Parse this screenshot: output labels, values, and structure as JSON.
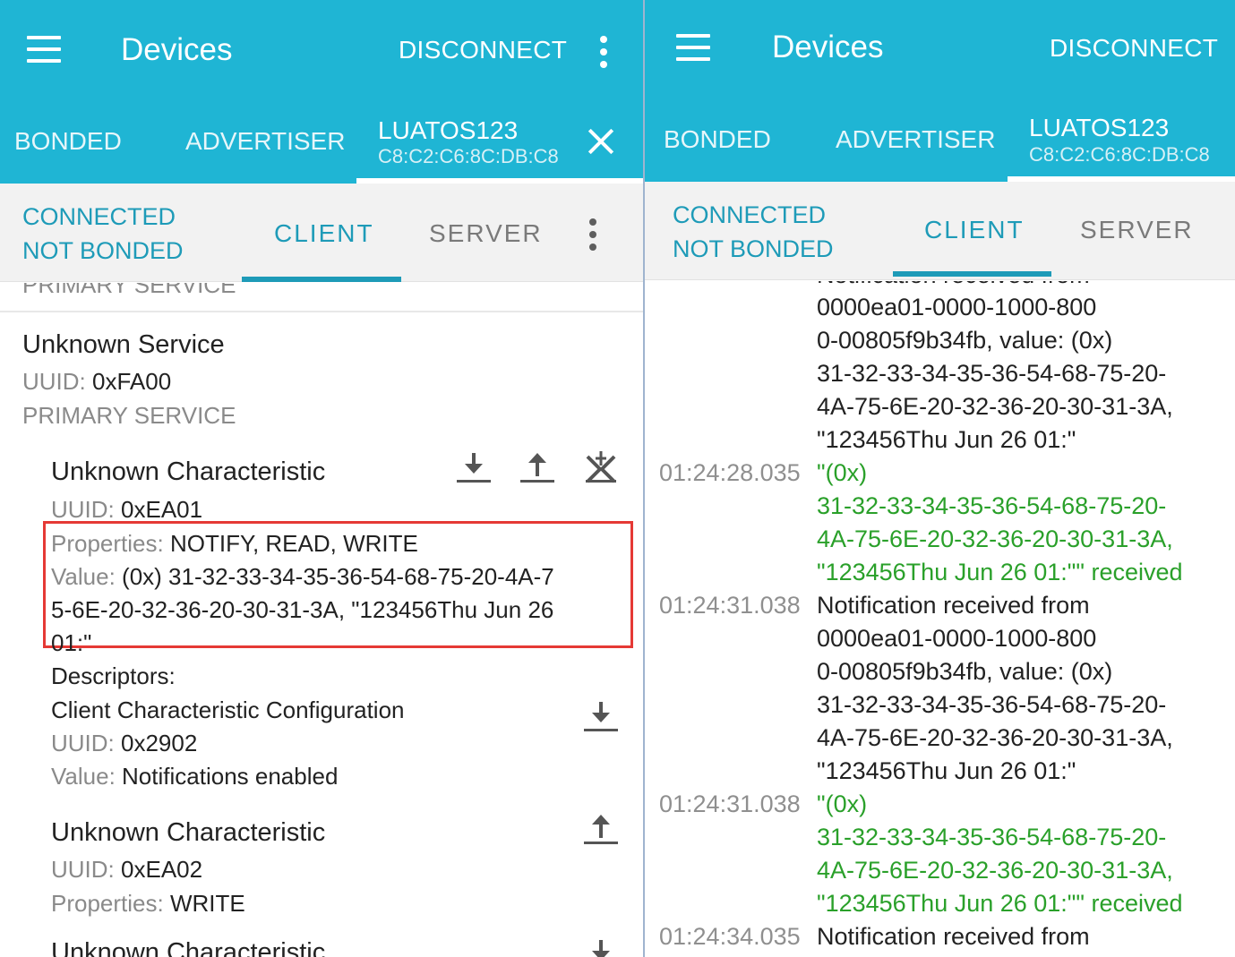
{
  "colors": {
    "appbar": "#1fb5d4",
    "accent": "#1e9bb8",
    "received": "#2aa02a",
    "highlight": "#e53935"
  },
  "left": {
    "appbar": {
      "title": "Devices",
      "disconnect": "DISCONNECT"
    },
    "tabs": {
      "bonded": "BONDED",
      "advertiser": "ADVERTISER",
      "device_name": "LUATOS123",
      "device_mac": "C8:C2:C6:8C:DB:C8"
    },
    "subbar": {
      "status_line1": "CONNECTED",
      "status_line2": "NOT BONDED",
      "client": "CLIENT",
      "server": "SERVER"
    },
    "service_partial": "PRIMARY SERVICE",
    "service": {
      "name": "Unknown Service",
      "uuid_label": "UUID:",
      "uuid": "0xFA00",
      "type": "PRIMARY SERVICE"
    },
    "char1": {
      "name": "Unknown Characteristic",
      "uuid_label": "UUID:",
      "uuid": "0xEA01",
      "properties_label": "Properties:",
      "properties": "NOTIFY, READ, WRITE",
      "value_label": "Value:",
      "value_line1": "(0x) 31-32-33-34-35-36-54-68-75-20-4A-7",
      "value_line2": "5-6E-20-32-36-20-30-31-3A, \"123456Thu Jun 26",
      "value_line3": "01:\"",
      "descriptors_label": "Descriptors:",
      "descriptor_name": "Client Characteristic Configuration",
      "descriptor_uuid_label": "UUID:",
      "descriptor_uuid": "0x2902",
      "descriptor_value_label": "Value:",
      "descriptor_value": "Notifications enabled",
      "icons": [
        "download-icon",
        "upload-icon",
        "notifications-off-icon"
      ]
    },
    "char2": {
      "name": "Unknown Characteristic",
      "uuid_label": "UUID:",
      "uuid": "0xEA02",
      "properties_label": "Properties:",
      "properties": "WRITE"
    },
    "char3_partial": "Unknown Characteristic"
  },
  "right": {
    "appbar": {
      "title": "Devices",
      "disconnect": "DISCONNECT"
    },
    "tabs": {
      "bonded": "BONDED",
      "advertiser": "ADVERTISER",
      "device_name": "LUATOS123",
      "device_mac": "C8:C2:C6:8C:DB:C8"
    },
    "subbar": {
      "status_line1": "CONNECTED",
      "status_line2": "NOT BONDED",
      "client": "CLIENT",
      "server": "SERVER"
    },
    "log": {
      "cut_top": "Notification received from",
      "entry1": [
        "0000ea01-0000-1000-800",
        "0-00805f9b34fb, value: (0x)",
        "31-32-33-34-35-36-54-68-75-20-",
        "4A-75-6E-20-32-36-20-30-31-3A,",
        "\"123456Thu Jun 26 01:\""
      ],
      "entry2_ts": "01:24:28.035",
      "entry2": [
        "\"(0x)",
        "31-32-33-34-35-36-54-68-75-20-",
        "4A-75-6E-20-32-36-20-30-31-3A,",
        "\"123456Thu Jun 26 01:\"\" received"
      ],
      "entry3_ts": "01:24:31.038",
      "entry3": [
        "Notification received from",
        "0000ea01-0000-1000-800",
        "0-00805f9b34fb, value: (0x)",
        "31-32-33-34-35-36-54-68-75-20-",
        "4A-75-6E-20-32-36-20-30-31-3A,",
        "\"123456Thu Jun 26 01:\""
      ],
      "entry4_ts": "01:24:31.038",
      "entry4": [
        "\"(0x)",
        "31-32-33-34-35-36-54-68-75-20-",
        "4A-75-6E-20-32-36-20-30-31-3A,",
        "\"123456Thu Jun 26 01:\"\" received"
      ],
      "entry5_ts": "01:24:34.035",
      "entry5": [
        "Notification received from"
      ]
    }
  }
}
